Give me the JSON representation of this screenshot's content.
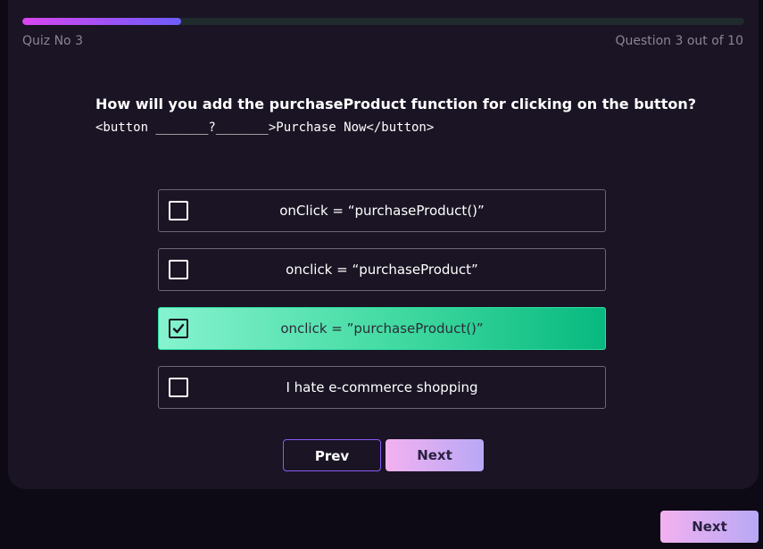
{
  "quiz": {
    "title": "Quiz No 3",
    "question_counter": "Question 3 out of 10",
    "progress": 0.22
  },
  "question": {
    "text": "How will you add the purchaseProduct function for clicking on the button?",
    "code": "<button _______?_______>Purchase Now</button>"
  },
  "options": [
    {
      "label": "onClick = “purchaseProduct()”",
      "selected": false
    },
    {
      "label": "onclick = “purchaseProduct”",
      "selected": false
    },
    {
      "label": "onclick = ”purchaseProduct()”",
      "selected": true
    },
    {
      "label": "I hate e-commerce shopping",
      "selected": false
    }
  ],
  "navigation": {
    "prev_label": "Prev",
    "next_label": "Next"
  },
  "footer": {
    "next_label": "Next"
  },
  "colors": {
    "background": "#0d0a15",
    "card": "#1a1424",
    "selected_option": "#07b97f",
    "accent": "#d946ef"
  }
}
